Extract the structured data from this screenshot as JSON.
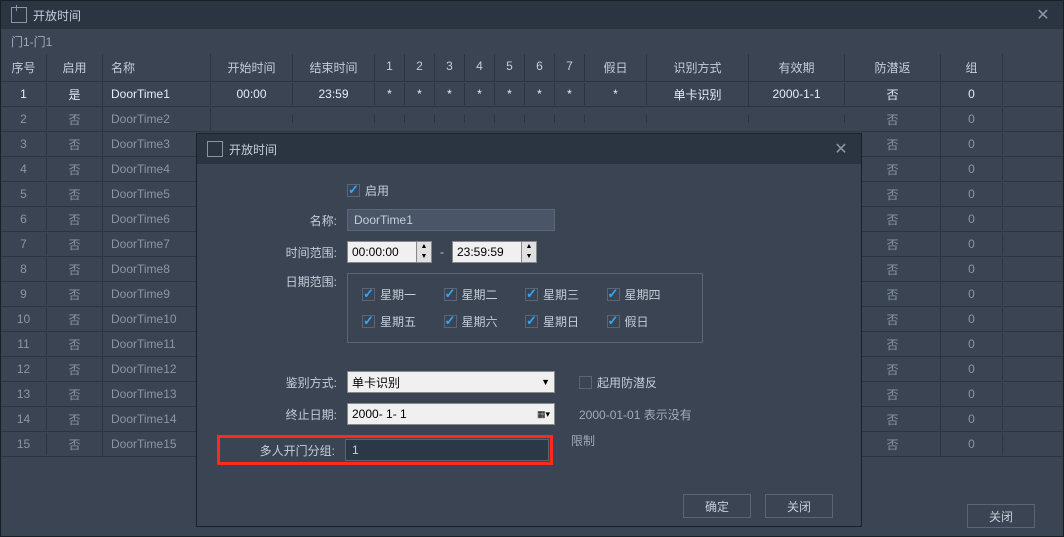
{
  "window": {
    "title": "开放时间",
    "breadcrumb": "门1-门1"
  },
  "columns": {
    "seq": "序号",
    "enable": "启用",
    "name": "名称",
    "start": "开始时间",
    "end": "结束时间",
    "d1": "1",
    "d2": "2",
    "d3": "3",
    "d4": "4",
    "d5": "5",
    "d6": "6",
    "d7": "7",
    "holiday": "假日",
    "recognize": "识别方式",
    "valid": "有效期",
    "anti": "防潜返",
    "group": "组"
  },
  "rows": [
    {
      "seq": "1",
      "enable": "是",
      "name": "DoorTime1",
      "start": "00:00",
      "end": "23:59",
      "d1": "*",
      "d2": "*",
      "d3": "*",
      "d4": "*",
      "d5": "*",
      "d6": "*",
      "d7": "*",
      "holiday": "*",
      "recognize": "单卡识别",
      "valid": "2000-1-1",
      "anti": "否",
      "group": "0"
    },
    {
      "seq": "2",
      "enable": "否",
      "name": "DoorTime2",
      "anti": "否",
      "group": "0"
    },
    {
      "seq": "3",
      "enable": "否",
      "name": "DoorTime3",
      "anti": "否",
      "group": "0"
    },
    {
      "seq": "4",
      "enable": "否",
      "name": "DoorTime4",
      "anti": "否",
      "group": "0"
    },
    {
      "seq": "5",
      "enable": "否",
      "name": "DoorTime5",
      "anti": "否",
      "group": "0"
    },
    {
      "seq": "6",
      "enable": "否",
      "name": "DoorTime6",
      "anti": "否",
      "group": "0"
    },
    {
      "seq": "7",
      "enable": "否",
      "name": "DoorTime7",
      "anti": "否",
      "group": "0"
    },
    {
      "seq": "8",
      "enable": "否",
      "name": "DoorTime8",
      "anti": "否",
      "group": "0"
    },
    {
      "seq": "9",
      "enable": "否",
      "name": "DoorTime9",
      "anti": "否",
      "group": "0"
    },
    {
      "seq": "10",
      "enable": "否",
      "name": "DoorTime10",
      "anti": "否",
      "group": "0"
    },
    {
      "seq": "11",
      "enable": "否",
      "name": "DoorTime11",
      "anti": "否",
      "group": "0"
    },
    {
      "seq": "12",
      "enable": "否",
      "name": "DoorTime12",
      "anti": "否",
      "group": "0"
    },
    {
      "seq": "13",
      "enable": "否",
      "name": "DoorTime13",
      "anti": "否",
      "group": "0"
    },
    {
      "seq": "14",
      "enable": "否",
      "name": "DoorTime14",
      "anti": "否",
      "group": "0"
    },
    {
      "seq": "15",
      "enable": "否",
      "name": "DoorTime15",
      "anti": "否",
      "group": "0"
    }
  ],
  "buttons": {
    "close_main": "关闭",
    "ok": "确定",
    "close_dlg": "关闭"
  },
  "dialog": {
    "title": "开放时间",
    "enable_label": "启用",
    "name_label": "名称:",
    "name_value": "DoorTime1",
    "time_label": "时间范围:",
    "time_start": "00:00:00",
    "time_dash": "-",
    "time_end": "23:59:59",
    "date_label": "日期范围:",
    "days": {
      "mon": "星期一",
      "tue": "星期二",
      "wed": "星期三",
      "thu": "星期四",
      "fri": "星期五",
      "sat": "星期六",
      "sun": "星期日",
      "hol": "假日"
    },
    "recognize_label": "鉴别方式:",
    "recognize_value": "单卡识别",
    "anti_label": "起用防潜反",
    "enddate_label": "终止日期:",
    "enddate_value": "2000-  1-  1",
    "enddate_hint1": "2000-01-01 表示没有",
    "enddate_hint2": "限制",
    "group_label": "多人开门分组:",
    "group_value": "1"
  }
}
